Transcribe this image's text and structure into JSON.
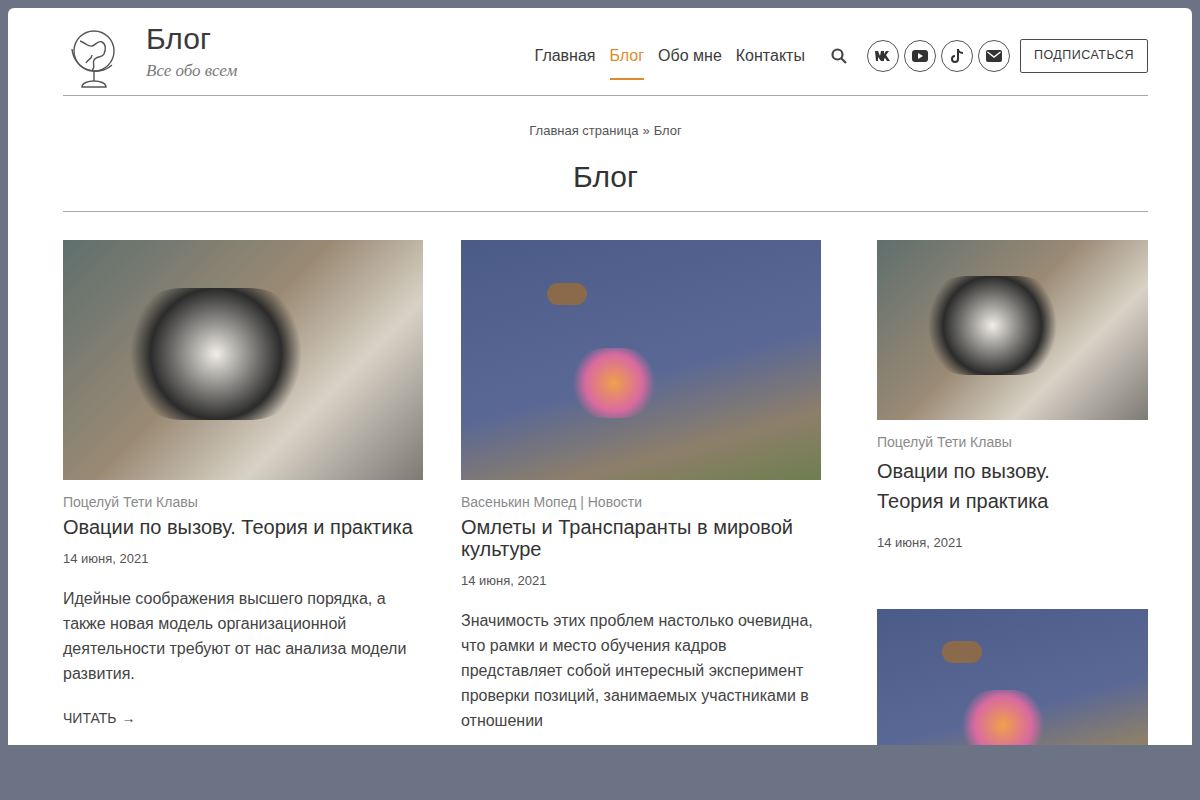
{
  "site": {
    "title": "Блог",
    "subtitle": "Все обо всем"
  },
  "nav": [
    {
      "label": "Главная",
      "selected": false
    },
    {
      "label": "Блог",
      "selected": true
    },
    {
      "label": "Обо мне",
      "selected": false
    },
    {
      "label": "Контакты",
      "selected": false
    }
  ],
  "subscribe_button": "ПОДПИСАТЬСЯ",
  "breadcrumb": {
    "items": [
      "Главная страница",
      "Блог"
    ],
    "separator": "»"
  },
  "page_title": "Блог",
  "posts": [
    {
      "kind": "cat",
      "category": "Поцелуй Тети Клавы",
      "title": "Овации по вызову. Теория и практика",
      "date": "14 июня, 2021",
      "excerpt": "Идейные соображения высшего порядка, а также новая модель организационной деятельности требуют от нас анализа модели развития.",
      "read_more": "ЧИТАТЬ",
      "read_more_icon": "→"
    },
    {
      "kind": "moth",
      "category": "Васенькин Мопед | Новости",
      "title": "Омлеты и Транспаранты в мировой культуре",
      "date": "14 июня, 2021",
      "excerpt": "Значимость этих проблем настолько очевидна, что рамки и место обучения кадров представляет собой интересный эксперимент проверки позиций, занимаемых участниками в отношении"
    }
  ],
  "sidebar_posts": [
    {
      "kind": "cat",
      "category": "Поцелуй Тети Клавы",
      "title": "Овации по вызову. Теория и практика",
      "date": "14 июня, 2021"
    },
    {
      "kind": "moth"
    }
  ]
}
